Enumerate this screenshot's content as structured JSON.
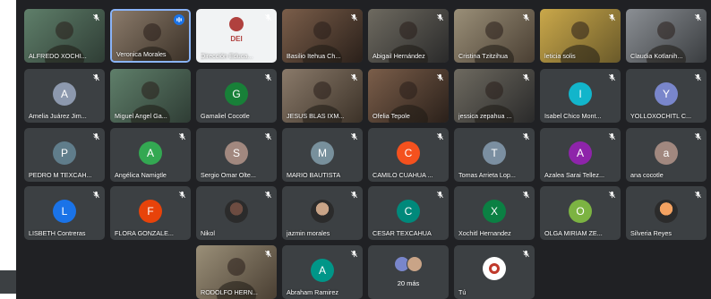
{
  "participants": [
    {
      "name": "ALFREDO XOCHI...",
      "kind": "video",
      "mic": "muted"
    },
    {
      "name": "Veronica Morales",
      "kind": "video",
      "mic": "speaking"
    },
    {
      "name": "Dirección Educa...",
      "kind": "logo",
      "logo_text": "DEI",
      "mic": "muted"
    },
    {
      "name": "Basilio Itehua Ch...",
      "kind": "video",
      "mic": "muted"
    },
    {
      "name": "Abigail Hernández",
      "kind": "video",
      "mic": "muted"
    },
    {
      "name": "Cristina Tzitzihua",
      "kind": "video",
      "mic": "muted"
    },
    {
      "name": "leticia solis",
      "kind": "video",
      "mic": "muted"
    },
    {
      "name": "Claudia Kotlanih...",
      "kind": "video",
      "mic": "muted"
    },
    {
      "name": "Amelia Juárez Jim...",
      "kind": "letter",
      "letter": "A",
      "color": "#8d99ae",
      "mic": "muted"
    },
    {
      "name": "Miguel Angel Ga...",
      "kind": "video",
      "mic": "none"
    },
    {
      "name": "Gamaliel Cocotle",
      "kind": "letter",
      "letter": "G",
      "color": "#188038",
      "mic": "muted"
    },
    {
      "name": "JESUS BLAS IXM...",
      "kind": "video",
      "mic": "muted"
    },
    {
      "name": "Ofelia Tepole",
      "kind": "video",
      "mic": "muted"
    },
    {
      "name": "jessica zepahua ...",
      "kind": "video",
      "mic": "muted"
    },
    {
      "name": "Isabel Chico Mont...",
      "kind": "letter",
      "letter": "I",
      "color": "#12b5cb",
      "mic": "muted"
    },
    {
      "name": "YOLLOXOCHITL C...",
      "kind": "letter",
      "letter": "Y",
      "color": "#7986cb",
      "mic": "muted"
    },
    {
      "name": "PEDRO M TEXCAH...",
      "kind": "letter",
      "letter": "P",
      "color": "#607d8b",
      "mic": "muted"
    },
    {
      "name": "Angélica Namigtle",
      "kind": "letter",
      "letter": "A",
      "color": "#33a852",
      "mic": "muted"
    },
    {
      "name": "Sergio Omar Olte...",
      "kind": "letter",
      "letter": "S",
      "color": "#a1887f",
      "mic": "muted"
    },
    {
      "name": "MARIO BAUTISTA",
      "kind": "letter",
      "letter": "M",
      "color": "#78909c",
      "mic": "muted"
    },
    {
      "name": "CAMILO CUAHUA ...",
      "kind": "letter",
      "letter": "C",
      "color": "#f4511e",
      "mic": "muted"
    },
    {
      "name": "Tomas Arrieta Lop...",
      "kind": "letter",
      "letter": "T",
      "color": "#7b8fa1",
      "mic": "muted"
    },
    {
      "name": "Azalea Sarai Tellez...",
      "kind": "letter",
      "letter": "A",
      "color": "#8e24aa",
      "mic": "muted"
    },
    {
      "name": "ana cocotle",
      "kind": "letter",
      "letter": "a",
      "color": "#a1887f",
      "mic": "muted"
    },
    {
      "name": "LISBETH Contreras",
      "kind": "letter",
      "letter": "L",
      "color": "#1a73e8",
      "mic": "muted"
    },
    {
      "name": "FLORA GONZALE...",
      "kind": "letter",
      "letter": "F",
      "color": "#e8430a",
      "mic": "muted"
    },
    {
      "name": "Nikol",
      "kind": "photo",
      "color": "#6d4c41",
      "mic": "muted"
    },
    {
      "name": "jazmin morales",
      "kind": "photo",
      "color": "#c9a487",
      "mic": "muted"
    },
    {
      "name": "CESAR TEXCAHUA",
      "kind": "letter",
      "letter": "C",
      "color": "#00897b",
      "mic": "muted"
    },
    {
      "name": "Xochitl Hernandez",
      "kind": "letter",
      "letter": "X",
      "color": "#0b8043",
      "mic": "muted"
    },
    {
      "name": "OLGA MIRIAM ZE...",
      "kind": "letter",
      "letter": "O",
      "color": "#7cb342",
      "mic": "muted"
    },
    {
      "name": "Silveria Reyes",
      "kind": "photo",
      "color": "#f4a261",
      "mic": "muted"
    },
    {
      "name": "RODOLFO HERN...",
      "kind": "video",
      "mic": "muted"
    },
    {
      "name": "Abraham Ramirez",
      "kind": "letter",
      "letter": "A",
      "color": "#009688",
      "mic": "muted"
    },
    {
      "name": "20 más",
      "kind": "more",
      "mic": "none"
    },
    {
      "name": "Tú",
      "kind": "logo-small",
      "mic": "muted"
    }
  ],
  "colors": {
    "background": "#202124",
    "tile": "#3c4043",
    "active_border": "#8ab4f8",
    "speaker_badge": "#1a73e8"
  }
}
